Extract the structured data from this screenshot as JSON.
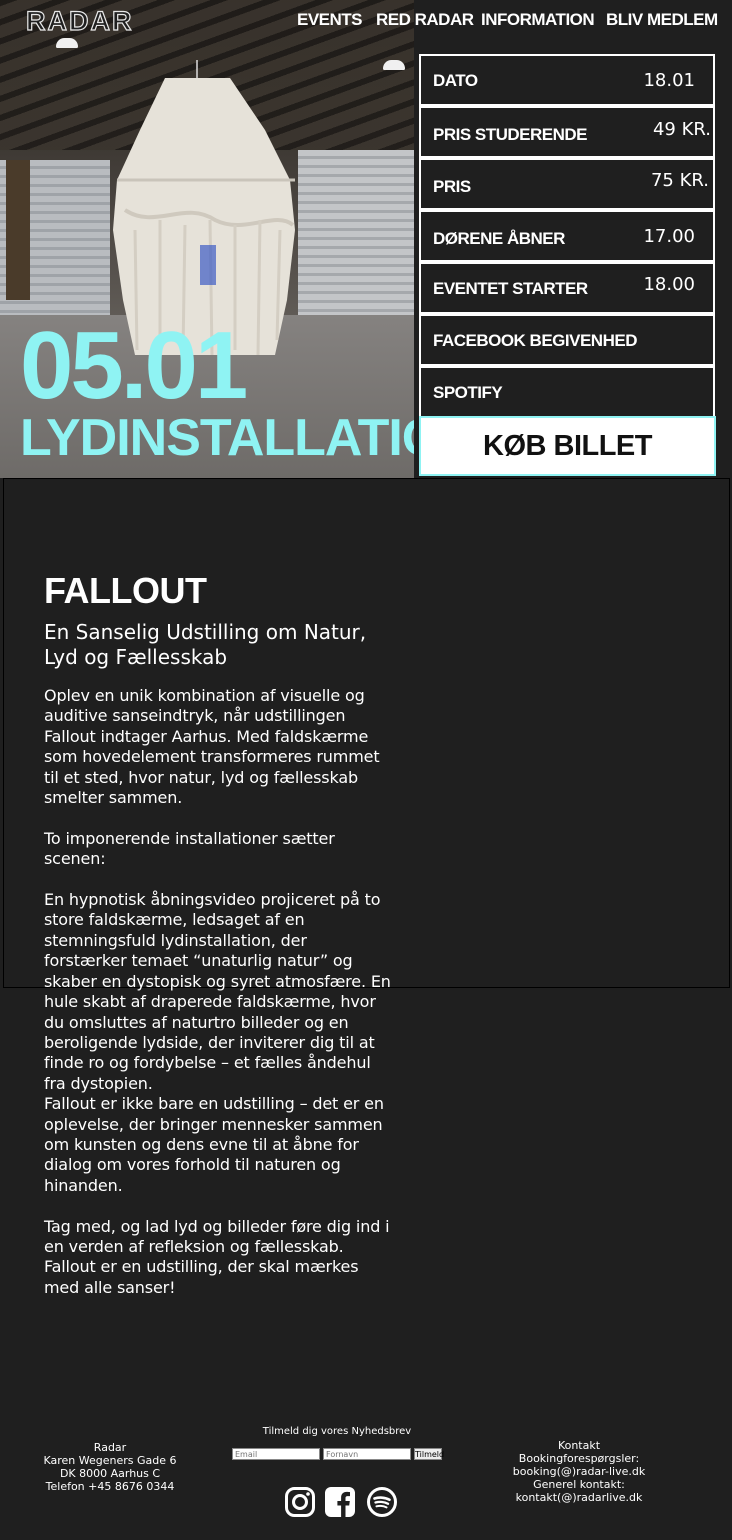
{
  "brand": {
    "logo": "RADAR"
  },
  "nav": {
    "items": [
      {
        "label": "EVENTS"
      },
      {
        "label": "RED RADAR"
      },
      {
        "label": "INFORMATION"
      },
      {
        "label": "BLIV MEDLEM"
      }
    ]
  },
  "hero": {
    "date": "05.01",
    "title": "LYDINSTALLATION",
    "accent_color": "#8ff3f3"
  },
  "info": {
    "rows": [
      {
        "label": "DATO",
        "value": "18.01"
      },
      {
        "label": "PRIS STUDERENDE",
        "value": "49 KR."
      },
      {
        "label": "PRIS",
        "value": "75 KR."
      },
      {
        "label": "DØRENE ÅBNER",
        "value": "17.00"
      },
      {
        "label": "EVENTET STARTER",
        "value": "18.00"
      },
      {
        "label": "FACEBOOK BEGIVENHED",
        "value": ""
      },
      {
        "label": "SPOTIFY",
        "value": ""
      }
    ],
    "buy_label": "KØB BILLET"
  },
  "article": {
    "title": "FALLOUT",
    "subtitle": "En Sanselig Udstilling om Natur, Lyd og Fællesskab",
    "body": "Oplev en unik kombination af visuelle og auditive sanseindtryk, når udstillingen Fallout indtager Aarhus. Med faldskærme som hovedelement transformeres rummet til et sted, hvor natur, lyd og fællesskab smelter sammen.\n\nTo imponerende installationer sætter scenen:\n\nEn hypnotisk åbningsvideo projiceret på to store faldskærme, ledsaget af en stemningsfuld lydinstallation, der forstærker temaet “unaturlig natur” og skaber en dystopisk og syret atmosfære. En hule skabt af draperede faldskærme, hvor du omsluttes af naturtro billeder og en beroligende lydside, der inviterer dig til at finde ro og fordybelse – et fælles åndehul fra dystopien.\nFallout er ikke bare en udstilling – det er en oplevelse, der bringer mennesker sammen om kunsten og dens evne til at åbne for dialog om vores forhold til naturen og hinanden.\n\nTag med, og lad lyd og billeder føre dig ind i en verden af refleksion og fællesskab. Fallout er en udstilling, der skal mærkes med alle sanser!"
  },
  "footer": {
    "address": {
      "name": "Radar",
      "street": "Karen Wegeners Gade 6",
      "city": "DK 8000 Aarhus C",
      "phone": "Telefon +45 8676 0344"
    },
    "newsletter": {
      "title": "Tilmeld dig vores Nyhedsbrev",
      "email_placeholder": "Email",
      "name_placeholder": "Fornavn",
      "submit_label": "Tilmeld"
    },
    "socials": [
      {
        "icon": "instagram-icon"
      },
      {
        "icon": "facebook-icon"
      },
      {
        "icon": "spotify-icon"
      }
    ],
    "contact": {
      "title": "Kontakt",
      "booking": "Bookingforespørgsler: booking(@)radar-live.dk",
      "general": "Generel kontakt: kontakt(@)radarlive.dk"
    }
  }
}
